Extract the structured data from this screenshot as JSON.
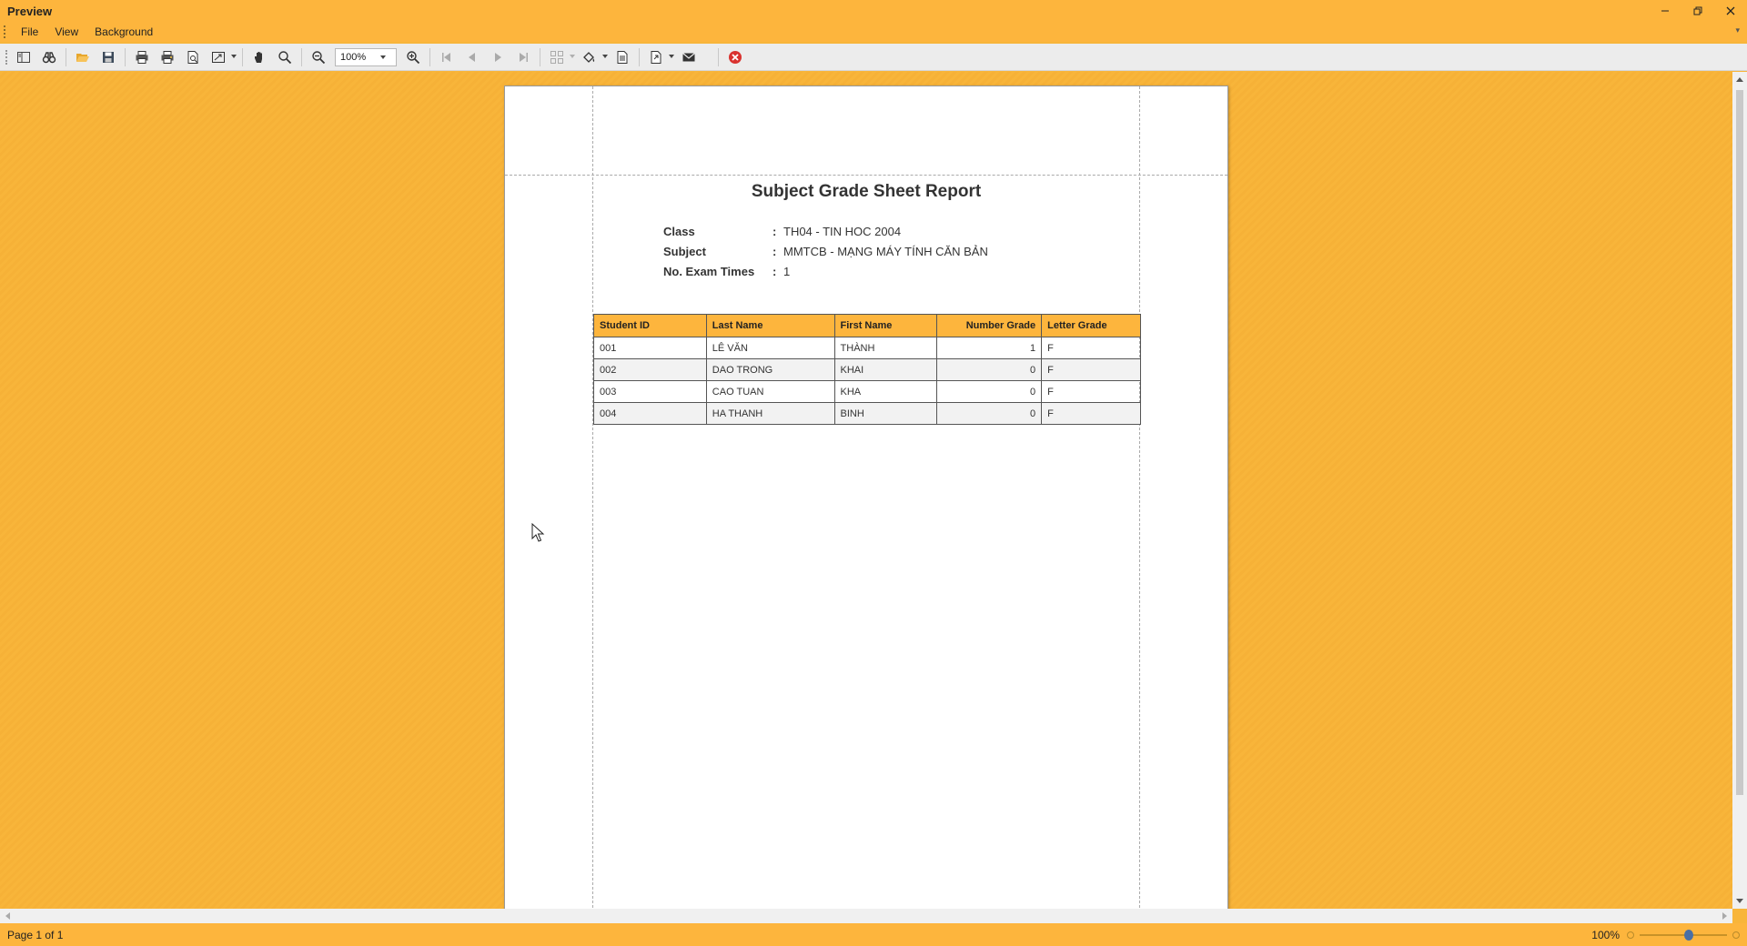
{
  "window": {
    "title": "Preview"
  },
  "menu": {
    "items": [
      "File",
      "View",
      "Background"
    ]
  },
  "toolbar": {
    "zoom_value": "100%"
  },
  "report": {
    "title": "Subject Grade Sheet Report",
    "info": [
      {
        "label": "Class",
        "colon": ":",
        "value": "TH04 - TIN HOC 2004"
      },
      {
        "label": "Subject",
        "colon": ":",
        "value": "MMTCB - MẠNG MÁY TÍNH CĂN BẢN"
      },
      {
        "label": "No. Exam Times",
        "colon": ":",
        "value": "1"
      }
    ],
    "columns": [
      "Student ID",
      "Last Name",
      "First Name",
      "Number Grade",
      "Letter Grade"
    ],
    "rows": [
      [
        "001",
        "LÊ VĂN",
        "THÀNH",
        "1",
        "F"
      ],
      [
        "002",
        "DAO TRONG",
        "KHAI",
        "0",
        "F"
      ],
      [
        "003",
        "CAO TUAN",
        "KHA",
        "0",
        "F"
      ],
      [
        "004",
        "HA THANH",
        "BINH",
        "0",
        "F"
      ]
    ]
  },
  "status": {
    "page_info": "Page 1 of 1",
    "zoom": "100%",
    "zoom_level_percent": 100
  },
  "colors": {
    "accent": "#fdb53d",
    "background": "#f8b53a",
    "header_fill": "#fdb53d"
  }
}
